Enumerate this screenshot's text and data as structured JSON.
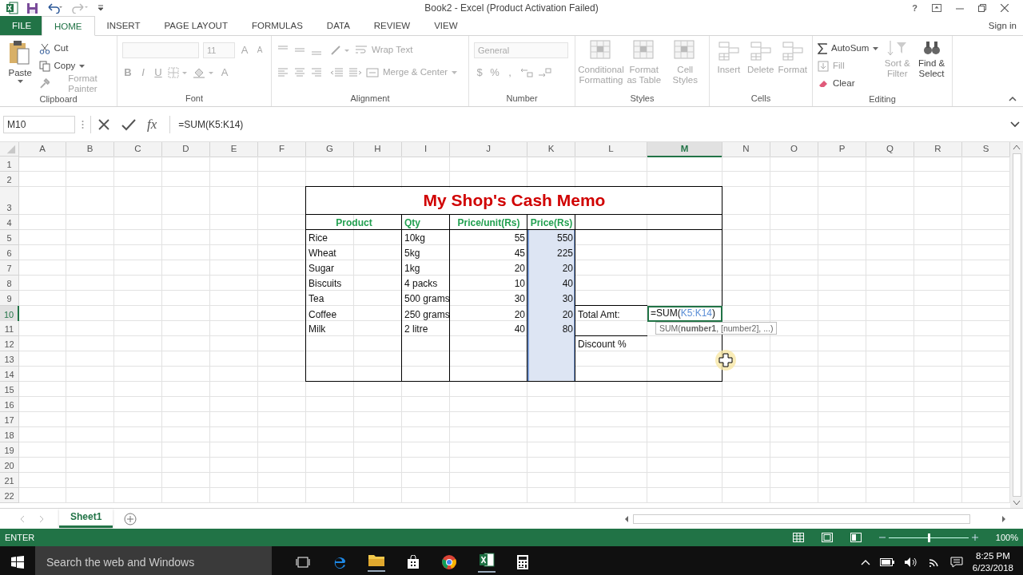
{
  "window": {
    "title": "Book2 - Excel (Product Activation Failed)",
    "help": "?",
    "sign_in": "Sign in"
  },
  "tabs": [
    {
      "label": "FILE",
      "kind": "file",
      "selected": false
    },
    {
      "label": "HOME",
      "kind": "tab",
      "selected": true
    },
    {
      "label": "INSERT",
      "kind": "tab",
      "selected": false
    },
    {
      "label": "PAGE LAYOUT",
      "kind": "tab",
      "selected": false
    },
    {
      "label": "FORMULAS",
      "kind": "tab",
      "selected": false
    },
    {
      "label": "DATA",
      "kind": "tab",
      "selected": false
    },
    {
      "label": "REVIEW",
      "kind": "tab",
      "selected": false
    },
    {
      "label": "VIEW",
      "kind": "tab",
      "selected": false
    }
  ],
  "ribbon": {
    "clipboard": {
      "title": "Clipboard",
      "paste": "Paste",
      "cut": "Cut",
      "copy": "Copy",
      "format_painter": "Format Painter"
    },
    "font": {
      "title": "Font",
      "size": "11",
      "grow": "A",
      "shrink": "A",
      "bold": "B",
      "italic": "I",
      "underline": "U",
      "font_color": "A"
    },
    "alignment": {
      "title": "Alignment",
      "wrap_text": "Wrap Text",
      "merge_center": "Merge & Center"
    },
    "number": {
      "title": "Number",
      "format": "General",
      "currency": "$",
      "percent": "%",
      "comma": ","
    },
    "styles": {
      "title": "Styles",
      "buttons": [
        "Conditional Formatting",
        "Format as Table",
        "Cell Styles"
      ]
    },
    "cells": {
      "title": "Cells",
      "buttons": [
        "Insert",
        "Delete",
        "Format"
      ]
    },
    "editing": {
      "title": "Editing",
      "autosum": "AutoSum",
      "fill": "Fill",
      "clear": "Clear",
      "sort_filter": "Sort & Filter",
      "find_select": "Find & Select"
    }
  },
  "formula_bar": {
    "name_box": "M10",
    "fx": "fx",
    "content": "=SUM(K5:K14)"
  },
  "sheet": {
    "columns": [
      {
        "label": "A",
        "selected": false
      },
      {
        "label": "B",
        "selected": false
      },
      {
        "label": "C",
        "selected": false
      },
      {
        "label": "D",
        "selected": false
      },
      {
        "label": "E",
        "selected": false
      },
      {
        "label": "F",
        "selected": false
      },
      {
        "label": "G",
        "selected": false
      },
      {
        "label": "H",
        "selected": false
      },
      {
        "label": "I",
        "selected": false
      },
      {
        "label": "J",
        "selected": false
      },
      {
        "label": "K",
        "selected": false
      },
      {
        "label": "L",
        "selected": false
      },
      {
        "label": "M",
        "selected": true
      },
      {
        "label": "N",
        "selected": false
      },
      {
        "label": "O",
        "selected": false
      },
      {
        "label": "P",
        "selected": false
      },
      {
        "label": "Q",
        "selected": false
      },
      {
        "label": "R",
        "selected": false
      },
      {
        "label": "S",
        "selected": false
      }
    ],
    "rows": [
      {
        "number": "1",
        "selected": false
      },
      {
        "number": "2",
        "selected": false
      },
      {
        "number": "3",
        "selected": false
      },
      {
        "number": "4",
        "selected": false
      },
      {
        "number": "5",
        "selected": false
      },
      {
        "number": "6",
        "selected": false
      },
      {
        "number": "7",
        "selected": false
      },
      {
        "number": "8",
        "selected": false
      },
      {
        "number": "9",
        "selected": false
      },
      {
        "number": "10",
        "selected": true
      },
      {
        "number": "11",
        "selected": false
      },
      {
        "number": "12",
        "selected": false
      },
      {
        "number": "13",
        "selected": false
      },
      {
        "number": "14",
        "selected": false
      },
      {
        "number": "15",
        "selected": false
      },
      {
        "number": "16",
        "selected": false
      },
      {
        "number": "17",
        "selected": false
      },
      {
        "number": "18",
        "selected": false
      },
      {
        "number": "19",
        "selected": false
      },
      {
        "number": "20",
        "selected": false
      },
      {
        "number": "21",
        "selected": false
      },
      {
        "number": "22",
        "selected": false
      }
    ]
  },
  "memo": {
    "title": "My Shop's Cash Memo",
    "headers": [
      "Product",
      "Qty",
      "Price/unit(Rs)",
      "Price(Rs)"
    ],
    "items": [
      {
        "product": "Rice",
        "qty": "10kg",
        "unit_price": "55",
        "price": "550"
      },
      {
        "product": "Wheat",
        "qty": "5kg",
        "unit_price": "45",
        "price": "225"
      },
      {
        "product": "Sugar",
        "qty": "1kg",
        "unit_price": "20",
        "price": "20"
      },
      {
        "product": "Biscuits",
        "qty": "4 packs",
        "unit_price": "10",
        "price": "40"
      },
      {
        "product": "Tea",
        "qty": "500 grams",
        "unit_price": "30",
        "price": "30"
      },
      {
        "product": "Coffee",
        "qty": "250 grams",
        "unit_price": "20",
        "price": "20"
      },
      {
        "product": "Milk",
        "qty": "2 litre",
        "unit_price": "40",
        "price": "80"
      }
    ],
    "price_selected": true,
    "total_label": "Total Amt:",
    "total_formula": {
      "prefix": "=SUM(",
      "reference": "K5:K14",
      "suffix": ")"
    },
    "tooltip": "SUM(**number1**, [number2], ...)",
    "discount_label": "Discount %"
  },
  "sheet_tabs": [
    {
      "label": "Sheet1",
      "selected": true
    }
  ],
  "status_bar": {
    "mode": "ENTER",
    "zoom": "100%",
    "level": 0.5
  },
  "taskbar": {
    "search_placeholder": "Search the web and Windows",
    "time": "8:25 PM",
    "date": "6/23/2018"
  }
}
